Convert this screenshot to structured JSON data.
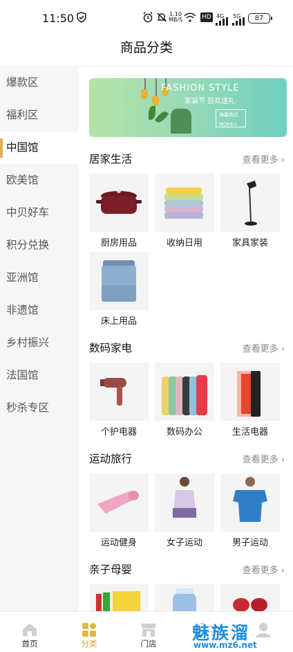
{
  "status_bar": {
    "time": "11:50",
    "net_speed": "1.10\nMB/S",
    "hd": "HD",
    "signal1": "4G",
    "signal2": "5G",
    "battery": "87"
  },
  "header": {
    "title": "商品分类"
  },
  "sidebar": {
    "items": [
      {
        "label": "爆款区"
      },
      {
        "label": "福利区"
      },
      {
        "label": "中国馆"
      },
      {
        "label": "欧美馆"
      },
      {
        "label": "中贝好车"
      },
      {
        "label": "积分兑换"
      },
      {
        "label": "亚洲馆"
      },
      {
        "label": "非遗馆"
      },
      {
        "label": "乡村振兴"
      },
      {
        "label": "法国馆"
      },
      {
        "label": "秒杀专区"
      }
    ],
    "active_index": 2
  },
  "banner": {
    "headline": "FASHION STYLE",
    "slogan": "家装节 狂欢送礼",
    "box_line1": "海量商品",
    "box_line2": "MORE>"
  },
  "sections": [
    {
      "title": "居家生活",
      "more": "查看更多",
      "items": [
        {
          "label": "厨房用品"
        },
        {
          "label": "收纳日用"
        },
        {
          "label": "家具家装"
        },
        {
          "label": "床上用品"
        }
      ]
    },
    {
      "title": "数码家电",
      "more": "查看更多",
      "items": [
        {
          "label": "个护电器"
        },
        {
          "label": "数码办公"
        },
        {
          "label": "生活电器"
        }
      ]
    },
    {
      "title": "运动旅行",
      "more": "查看更多",
      "items": [
        {
          "label": "运动健身"
        },
        {
          "label": "女子运动"
        },
        {
          "label": "男子运动"
        }
      ]
    },
    {
      "title": "亲子母婴",
      "more": "查看更多",
      "items": [
        {
          "label": ""
        },
        {
          "label": ""
        },
        {
          "label": ""
        }
      ]
    }
  ],
  "tabbar": {
    "items": [
      {
        "label": "首页"
      },
      {
        "label": "分类"
      },
      {
        "label": "门店"
      }
    ],
    "active_index": 1
  },
  "watermark": {
    "text": "魅族溜",
    "url": "www.mz6.net"
  },
  "colors": {
    "accent": "#d9a72e",
    "sidebar_bg": "#f6f6f6",
    "watermark": "#1a8fe3"
  }
}
